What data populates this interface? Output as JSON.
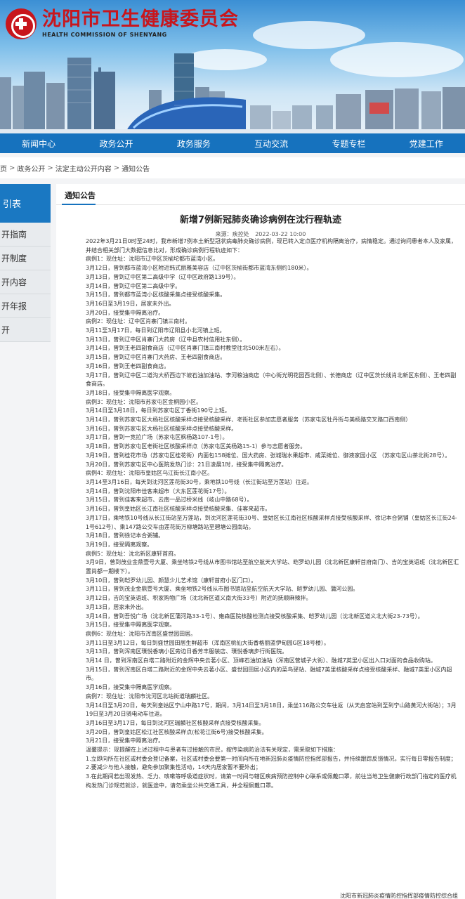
{
  "header": {
    "title_cn": "沈阳市卫生健康委员会",
    "title_en": "HEALTH COMMISSION OF SHENYANG"
  },
  "nav": [
    "新闻中心",
    "政务公开",
    "政务服务",
    "互动交流",
    "专题专栏",
    "党建工作"
  ],
  "breadcrumb": [
    "页",
    "政务公开",
    "法定主动公开内容",
    "通知公告"
  ],
  "sidebar": {
    "head": "引表",
    "items": [
      "开指南",
      "开制度",
      "开内容",
      "开年报",
      "开"
    ]
  },
  "tab": "通知公告",
  "article": {
    "title": "新增7例新冠肺炎确诊病例在沈行程轨迹",
    "source": "来源：疾控处",
    "date": "2022-03-22 10:00",
    "intro": "2022年3月21日0时至24时，我市新增7例本土新型冠状病毒肺炎确诊病例，现已转入定点医疗机构隔离治疗，病情稳定。通过询问患者本人及家属，并结合相关部门大数据信息比对，形成确诊病例行程轨迹如下：",
    "lines": [
      {
        "t": "病例1：现住址：沈阳市辽中区茨榆坨都市蓝湾小区。",
        "h": true
      },
      {
        "t": "3月12日，曾到都市蓝湾小区附近韩式丽雅美容店（辽中区茨榆街都市蓝湾东侧约180米）。"
      },
      {
        "t": "3月13日，曾到辽中区第二高级中学（辽中区政府路139号）。"
      },
      {
        "t": "3月14日，曾到辽中区第二高级中学。"
      },
      {
        "t": "3月15日，曾到都市蓝湾小区核酸采集点接受核酸采集。"
      },
      {
        "t": "3月16日至3月19日，居家未外出。"
      },
      {
        "t": "3月20日，接受集中隔离治疗。"
      },
      {
        "t": "病例2：现住址：辽中区肖寨门镇三南村。",
        "h": true
      },
      {
        "t": "3月11至3月17日，每日到辽阳市辽阳县小北河镇上班。"
      },
      {
        "t": "3月13日，曾到辽中区肖寨门大药房（辽中县农村信用社东侧）。"
      },
      {
        "t": "3月14日，曾到王老四副食商店（辽中区肖寨门镇三南村教堂往北500米左右）。"
      },
      {
        "t": "3月15日，曾到辽中区肖寨门大药房、王老四副食商店。"
      },
      {
        "t": "3月16日，曾到王老四副食商店。"
      },
      {
        "t": "3月17日，曾到辽中区二道沟大桥西边下坡石油加油站、李河粮油商店（中心街光明花园西北侧）、长德商店（辽中区茨长线肖北新区东侧）、王老四副食商店。"
      },
      {
        "t": "3月18日，接受集中隔离医学观察。"
      },
      {
        "t": "病例3：现住址：沈阳市苏家屯区金桐园小区。",
        "h": true
      },
      {
        "t": "3月14日至3月18日，每日到苏家屯区丁香街190号上班。"
      },
      {
        "t": "3月14日，曾到苏家屯区大杨社区核酸采样点接受核酸采样、老街社区参加志愿者服务（苏家屯区牡丹街与美杨路交叉路口西南侧）"
      },
      {
        "t": "3月16日，曾到苏家屯区大杨社区核酸采样点接受核酸采样。"
      },
      {
        "t": "3月17日，曾到一竞拉广场（苏家屯区枫杨路107-1号）。"
      },
      {
        "t": "3月18日，曾到苏家屯区老街社区核酸采样点（苏家屯区美杨路15-1）参与志愿者服务。"
      },
      {
        "t": "3月19日，曾到桂花市场（苏家屯区桂花街）内面包158摊位、国大药房、张城瑞水果超市、咸菜摊位、御液家园小区 （苏家屯区山茶北街28号）。"
      },
      {
        "t": "3月20日，曾到苏家屯区中心医院发热门诊：21日凌晨1时，接受集中隔离治疗。"
      },
      {
        "t": "病例4：现住址：沈阳市皇姑区乌江街长江南小区。",
        "h": true
      },
      {
        "t": "3月14至3月16日，每天到沈河区莲花街30号，乘地铁10号线（长江街站至万莲站）往返。"
      },
      {
        "t": "3月14日，曾到沈阳市佳客来超市（大东区莲花街17号）。"
      },
      {
        "t": "3月15日，曾到佳客来超市、云南一品过桥米线（岐山中路68号）。"
      },
      {
        "t": "3月16日，曾到皇姑区长江南社区核酸采样点接受核酸采集、佳客来超市。"
      },
      {
        "t": "3月17日，乘地铁10号线从长江街站至万莲站，到沈河区莲花街30号、皇姑区长江南社区核酸采样点接受核酸采样、徐记本合粥铺（皇姑区长江街24-1号612号）、乘147路公交车由莲花街万柳塘路站至碧塘公园南站。"
      },
      {
        "t": "3月18日，曾到徐记本合粥铺。"
      },
      {
        "t": "3月19日，接受隔离观察。"
      },
      {
        "t": "病例5：现住址：沈北新区康轩首府。",
        "h": true
      },
      {
        "t": "3月9日，曾到茂业金鼎壹号大厦、乘坐地铁2号线从市图书馆站至航空航天大学站、皑罗幼儿园（沈北新区康轩首府南门）、吉的宝英语班（沈北新区汇置尚都一期楼下）。"
      },
      {
        "t": "3月10日，曾到皑罗幼儿园、颜慧少儿艺术馆（康轩首府小区门口）。"
      },
      {
        "t": "3月11日，曾到茂业金鼎壹号大厦、乘坐地铁2号线从市图书馆站至航空航天大学站、皑罗幼儿园、蒲河公园。"
      },
      {
        "t": "3月12日，吉的宝英语班、积家购物广场（沈北新区道义南大街33号）附近的抚顺麻辣拌。"
      },
      {
        "t": "3月13日，居家未外出。"
      },
      {
        "t": "3月14日，曾到吾悦广场（沈北新区蒲河路33-1号）、雍森医院核酸检测点接受核酸采集、皑罗幼儿园（沈北新区道义北大街23-73号）。"
      },
      {
        "t": "3月15日，接受集中隔离医学观察。"
      },
      {
        "t": "病例6：现住址：沈阳市浑南区盛世园田居。",
        "h": true
      },
      {
        "t": "3月11日至3月12日，每日到盛世园田居生鲜超市（浑南区桃仙大街香格丽蓝伊甸园G区18号楼）。"
      },
      {
        "t": "3月13日，曾到浑南区璞悦香璃小区旁边日香芳丰服装店、璞悦香璃步行街医院。"
      },
      {
        "t": "3月14 日，曾到浑南区白塔二路附近的金辉中央云著小区、顶峰石油加油站（浑南区营城子大街）、融城7英里小区出入口对面的食品收购站。"
      },
      {
        "t": "3月15日，曾到浑南区白塔二路附近的金辉中央云著小区、盛世园田居小区内的菜鸟驿站、融城7英里核酸采样点接受核酸采样、融城7英里小区内超市。"
      },
      {
        "t": "3月16日，接受集中隔离医学观察。"
      },
      {
        "t": "病例7：现住址：沈阳市沈河区北站街道瑞麟社区。",
        "h": true
      },
      {
        "t": "3月14日至3月20日，每天到皇姑区宁山中路17号，期间，3月14日至3月18日，乘坐116路公交车往返（从天启宫站到至到宁山路黄河大街站）；3月19日至3月20日骑电动车往返。"
      },
      {
        "t": "3月16日至3月17日，每日到沈河区瑞麟社区核酸采样点接受核酸采集。"
      },
      {
        "t": "3月20日，曾到皇姑区松江社区核酸采样点(松花江街6号)接受核酸采集。"
      },
      {
        "t": "3月21日，接受集中隔离治疗。"
      },
      {
        "t": "温馨提示：现提醒在上述过程中与患者有过接触的市民，按传染病防治法有关规定，需采取如下措施：",
        "h": true
      },
      {
        "t": "1.立即向所在社区或村委会登记备案，社区或村委会要第一时间向所在地新冠肺炎疫情防控指挥部报告，并持续跟踪反馈情况，实行每日零报告制度；"
      },
      {
        "t": "2.要减少与他人接触，避免参加聚集性活动，14天内居家暂不要外出；"
      },
      {
        "t": "3.在此期间若出现发热、乏力、咳嗽等呼吸道症状时，请第一时间与辖区疾病预防控制中心联系或佩戴口罩，前往当地卫生健康行政部门指定的医疗机构发热门诊规范就诊，就医途中，请勿乘坐公共交通工具，并全程佩戴口罩。"
      }
    ],
    "signature": "沈阳市新冠肺炎疫情防控指挥部疫情防控综合组"
  },
  "colors": {
    "brand_red": "#c8161d",
    "nav_blue": "#1672be",
    "sidebar_blue": "#1a78c2"
  }
}
